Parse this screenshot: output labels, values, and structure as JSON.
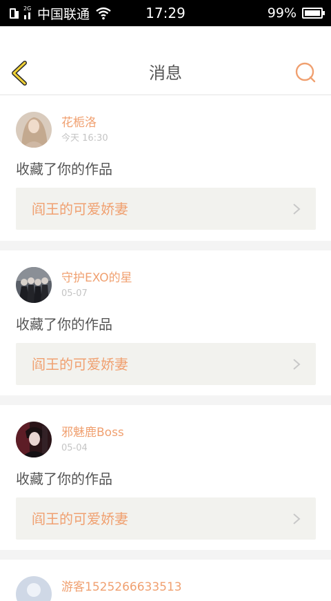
{
  "status_bar": {
    "network": "2G",
    "carrier": "中国联通",
    "time": "17:29",
    "battery_text": "99%",
    "battery_level": 0.99
  },
  "header": {
    "title": "消息",
    "back_icon": "chevron-left-icon",
    "search_icon": "search-icon"
  },
  "colors": {
    "accent": "#f0a070",
    "back_accent": "#f1d236",
    "text_main": "#555555",
    "text_muted": "#c4c4c4",
    "card_link_bg": "#f2f2ee",
    "page_bg": "#f4f4f4"
  },
  "messages": [
    {
      "username": "花栀洛",
      "time": "今天 16:30",
      "action": "收藏了你的作品",
      "work_title": "阎王的可爱娇妻"
    },
    {
      "username": "守护EXO的星",
      "time": "05-07",
      "action": "收藏了你的作品",
      "work_title": "阎王的可爱娇妻"
    },
    {
      "username": "邪魅鹿Boss",
      "time": "05-04",
      "action": "收藏了你的作品",
      "work_title": "阎王的可爱娇妻"
    },
    {
      "username": "游客1525266633513",
      "time": "",
      "action": "",
      "work_title": ""
    }
  ]
}
